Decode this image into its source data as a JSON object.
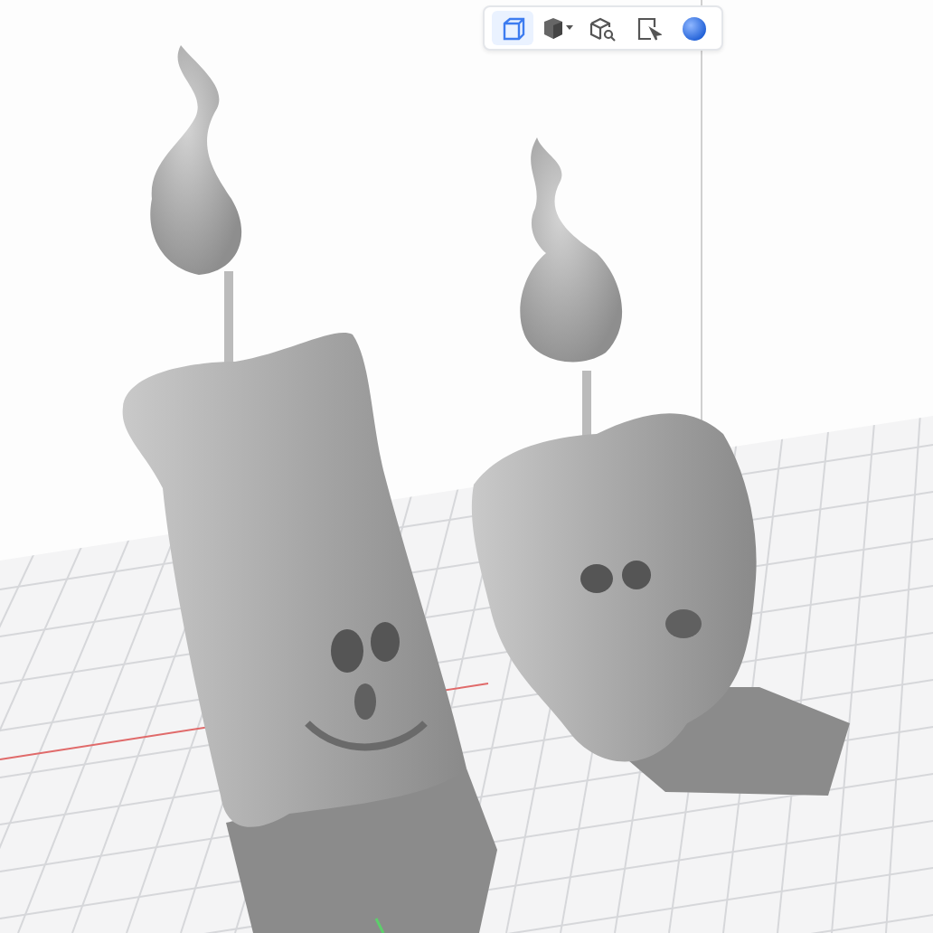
{
  "toolbar": [
    {
      "kind": "view-cube",
      "selected": true
    },
    {
      "kind": "shading",
      "selected": false
    },
    {
      "kind": "inspect",
      "selected": false
    },
    {
      "kind": "select",
      "selected": false
    },
    {
      "kind": "material",
      "selected": false
    }
  ]
}
